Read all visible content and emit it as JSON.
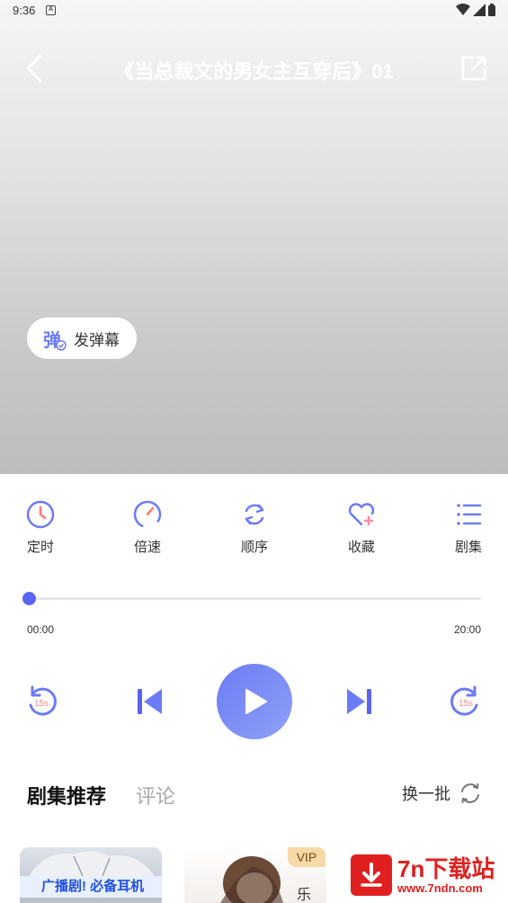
{
  "status": {
    "time": "9:36",
    "a_icon": "A"
  },
  "header": {
    "title": "《当总裁文的男女主互穿后》01"
  },
  "danmaku": {
    "label": "发弹幕",
    "icon_char": "弹"
  },
  "controls": [
    {
      "label": "定时",
      "icon": "clock-icon"
    },
    {
      "label": "倍速",
      "icon": "speedometer-icon"
    },
    {
      "label": "顺序",
      "icon": "repeat-icon"
    },
    {
      "label": "收藏",
      "icon": "heart-plus-icon"
    },
    {
      "label": "剧集",
      "icon": "list-icon"
    }
  ],
  "progress": {
    "current": "00:00",
    "total": "20:00",
    "fraction": 0
  },
  "player": {
    "rewind_label": "15s",
    "forward_label": "15s"
  },
  "tabs": {
    "active": "剧集推荐",
    "inactive": "评论"
  },
  "refresh": {
    "label": "换一批"
  },
  "thumbs": {
    "banner_text": "广播剧! 必备耳机",
    "vip": "VIP"
  },
  "watermark": {
    "title": "7n下载站",
    "url": "www.7ndn.com"
  },
  "colors": {
    "accent": "#6b7cf4",
    "accent_dark": "#5865f2",
    "watermark": "#e02020"
  }
}
